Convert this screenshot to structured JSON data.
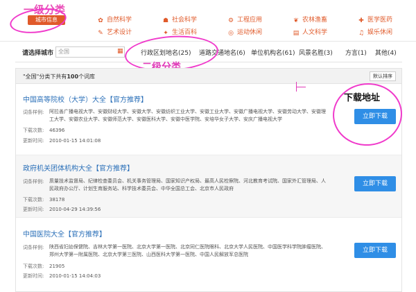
{
  "annotations": {
    "level1": "一级分类",
    "level2": "二级分类",
    "download": "下载地址"
  },
  "topnav": {
    "current_category": "城市信息",
    "categories": [
      {
        "label": "自然科学",
        "icon": "leaf-icon"
      },
      {
        "label": "社会科学",
        "icon": "people-icon"
      },
      {
        "label": "工程应用",
        "icon": "gear-icon"
      },
      {
        "label": "农林渔畜",
        "icon": "plant-icon"
      },
      {
        "label": "医学医药",
        "icon": "medical-icon"
      },
      {
        "label": "艺术设计",
        "icon": "palette-icon"
      },
      {
        "label": "生活百科",
        "icon": "life-icon"
      },
      {
        "label": "运动休闲",
        "icon": "sport-icon"
      },
      {
        "label": "人文科学",
        "icon": "book-icon"
      },
      {
        "label": "娱乐休闲",
        "icon": "entertainment-icon"
      }
    ]
  },
  "filter": {
    "label": "请选择城市",
    "search_value": "全国",
    "tabs": [
      "行政区划地名(25)",
      "道路交通地名(6)",
      "单位机构名(61)",
      "风景名胜(3)",
      "方言(1)",
      "其他(4)"
    ]
  },
  "panel": {
    "header_prefix": "\"全国\"分类下共有",
    "header_count": "100",
    "header_suffix": "个词库",
    "sort_label": "默认排序"
  },
  "labels": {
    "examples": "词条样例:",
    "downloads": "下载次数:",
    "updated": "更新时间:",
    "download_button": "立即下载"
  },
  "items": [
    {
      "title": "中国高等院校（大学）大全【官方推荐】",
      "examples": "阿拉善广播电视大学、安徽财经大学、安徽大学、安徽纺织工业大学、安徽工业大学、安徽广播电视大学、安徽劳动大学、安徽理工大学、安徽农业大学、安徽师范大学、安徽医科大学、安徽中医学院、安培华女子大学、安庆广播电视大学",
      "downloads": "46396",
      "updated": "2010-01-15 14:01:08"
    },
    {
      "title": "政府机关团体机构大全【官方推荐】",
      "examples": "质量技术监督局、纪律检查委员会、机关事务管理局、国家知识产权局、最高人民检察院、河北教育考试院、国家外汇管理局、人民政府办公厅、计划生育服务站、科学技术委员会、中华全国总工会、北京市人民政府",
      "downloads": "38178",
      "updated": "2010-04-29 14:39:56"
    },
    {
      "title": "中国医院大全【官方推荐】",
      "examples": "陕西省妇幼保健院、吉林大学第一医院、北京大学第一医院、北京同仁医院眼科、北京大学人民医院、中国医学科学院肿瘤医院、郑州大学第一附属医院、北京大学第三医院、山西医科大学第一医院、中国人民解放军总医院",
      "downloads": "21905",
      "updated": "2010-01-15 14:04:03"
    }
  ]
}
